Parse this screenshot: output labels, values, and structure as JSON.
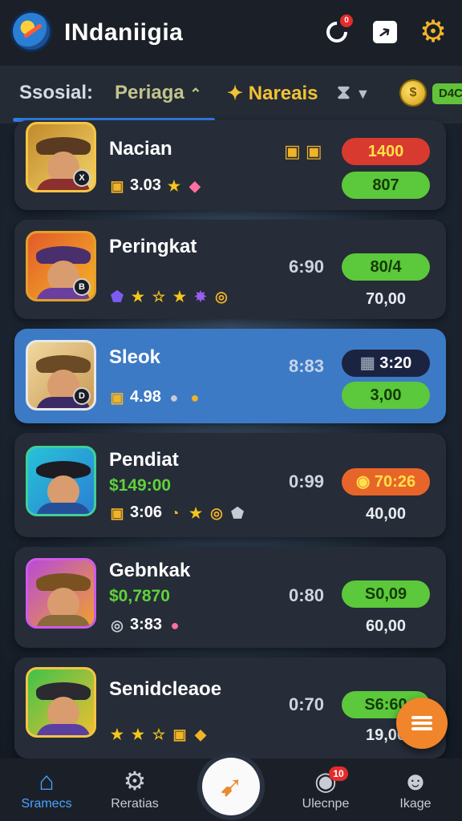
{
  "header": {
    "title": "INdaniigia",
    "notification_count": "0",
    "icons": {
      "logo": "compass-logo",
      "refresh": "refresh-icon",
      "share": "share-icon",
      "settings": "gear-icon"
    }
  },
  "tabs": [
    {
      "label": "Ssosial:",
      "color": "#d6dbe3"
    },
    {
      "label": "Periaga",
      "color": "#c2c48c"
    },
    {
      "label": "Nareais",
      "color": "#f2c233"
    }
  ],
  "currency": {
    "cash_label": "D4C"
  },
  "players": [
    {
      "name": "Nacian",
      "stat_value": "3.03",
      "mid_value": "",
      "pill": "1400",
      "pill_style": "red",
      "pill2": "807",
      "pill2_style": "green",
      "badge": "X"
    },
    {
      "name": "Peringkat",
      "stat_value": "",
      "mid_value": "6:90",
      "pill": "80/4",
      "pill_style": "green",
      "value2": "70,00",
      "badge": "B"
    },
    {
      "name": "Sleok",
      "stat_value": "4.98",
      "mid_value": "8:83",
      "pill": "3:20",
      "pill_style": "navy",
      "pill2": "3,00",
      "pill2_style": "green",
      "badge": "D"
    },
    {
      "name": "Pendiat",
      "sub_value": "$149:00",
      "stat_value": "3:06",
      "mid_value": "0:99",
      "pill": "70:26",
      "pill_style": "orange",
      "value2": "40,00",
      "badge": ""
    },
    {
      "name": "Gebnkak",
      "sub_value": "$0,7870",
      "stat_value": "3:83",
      "mid_value": "0:80",
      "pill": "S0,09",
      "pill_style": "green",
      "value2": "60,00",
      "badge": ""
    },
    {
      "name": "Senidcleaoe",
      "stat_value": "",
      "mid_value": "0:70",
      "pill": "S6:60",
      "pill_style": "green",
      "value2": "19,00",
      "badge": ""
    }
  ],
  "nav": [
    {
      "label": "Sramecs",
      "icon": "home-icon"
    },
    {
      "label": "Reratias",
      "icon": "gear-icon"
    },
    {
      "label": "",
      "icon": "play-icon"
    },
    {
      "label": "Ulecnpe",
      "icon": "chat-icon",
      "badge": "10"
    },
    {
      "label": "Ikage",
      "icon": "profile-icon"
    }
  ]
}
